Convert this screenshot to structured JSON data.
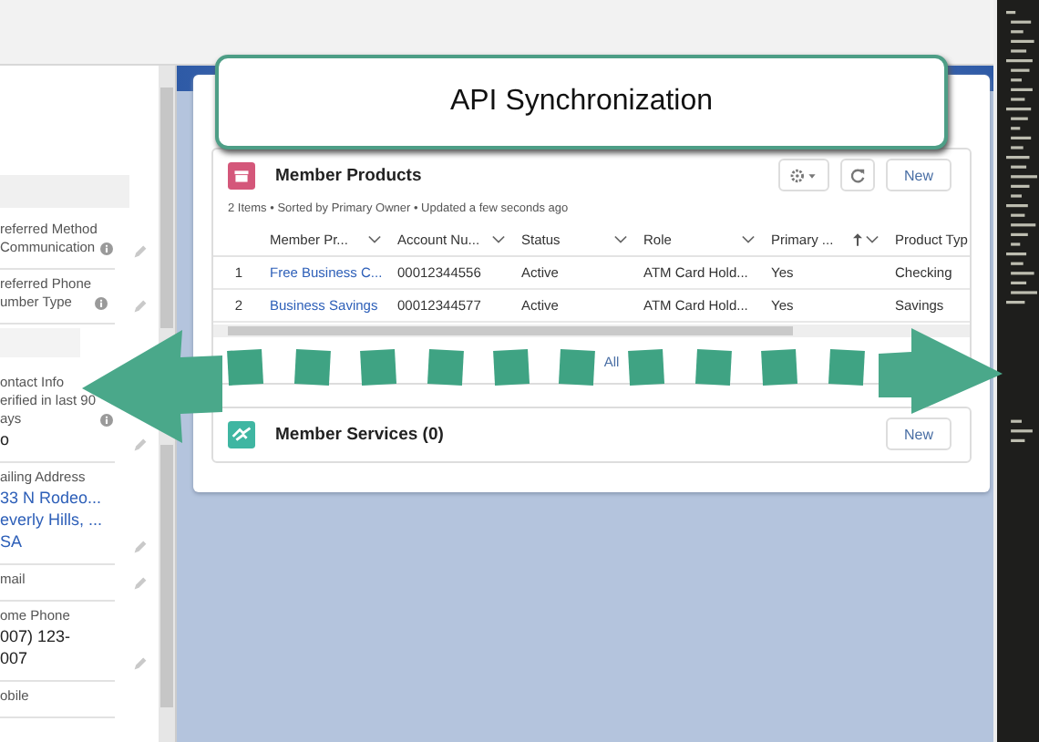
{
  "callout": {
    "text": "API Synchronization"
  },
  "left_panel": {
    "fields": [
      {
        "label": "referred Method\nCommunication",
        "info": true,
        "editable": true
      },
      {
        "label": "referred Phone\number Type",
        "info": true,
        "editable": true
      },
      {
        "kind": "section"
      },
      {
        "label": "ontact Info\nerified in last 90\nays",
        "info": true,
        "editable": true,
        "value": "o",
        "link": false
      },
      {
        "label": "ailing Address",
        "info": false,
        "editable": true,
        "value": "33 N Rodeo...\neverly Hills, ...\nSA",
        "link": true
      },
      {
        "label": "mail",
        "info": false,
        "editable": true
      },
      {
        "label": "ome Phone",
        "info": false,
        "editable": true,
        "value": "007) 123-\n007",
        "link": false
      },
      {
        "label": "obile",
        "info": false,
        "editable": false
      }
    ]
  },
  "member_products": {
    "title": "Member Products",
    "subtitle": "2 Items • Sorted by Primary Owner • Updated a few seconds ago",
    "new_button": "New",
    "table": {
      "columns": [
        {
          "label": "Member Pr...",
          "sorted": false
        },
        {
          "label": "Account Nu...",
          "sorted": false
        },
        {
          "label": "Status",
          "sorted": false
        },
        {
          "label": "Role",
          "sorted": false
        },
        {
          "label": "Primary ...",
          "sorted": true
        },
        {
          "label": "Product Typ",
          "sorted": false
        }
      ],
      "rows": [
        {
          "number": "1",
          "cells": [
            "Free Business C...",
            "00012344556",
            "Active",
            "ATM Card Hold...",
            "Yes",
            "Checking"
          ]
        },
        {
          "number": "2",
          "cells": [
            "Business Savings",
            "00012344577",
            "Active",
            "ATM Card Hold...",
            "Yes",
            "Savings"
          ]
        }
      ]
    },
    "footer_link": "All"
  },
  "member_services": {
    "title": "Member Services (0)",
    "new_button": "New"
  }
}
